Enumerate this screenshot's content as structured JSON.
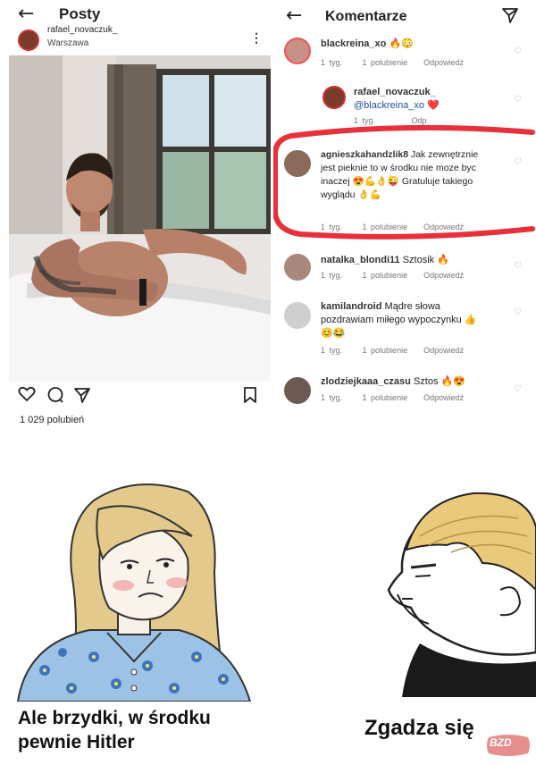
{
  "posts_screen": {
    "title": "Posty",
    "username": "rafael_novaczuk_",
    "location": "Warszawa",
    "likes_text": "1 029 polubień"
  },
  "comments_screen": {
    "title": "Komentarze",
    "comments": [
      {
        "user": "blackreina_xo",
        "text": "🔥😳",
        "time": "1 tyg.",
        "likes": "1 polubienie",
        "reply": "Odpowiedź"
      },
      {
        "user": "rafael_novaczuk_",
        "text": "@blackreina_xo ❤️",
        "time": "1 tyg.",
        "likes": "",
        "reply": "Odp"
      },
      {
        "user": "agnieszkahandzlik8",
        "text": "Jak zewnętrznie jest pieknie to w środku nie moze byc  inaczej 😍💪👌😜 Gratuluje takiego wyglądu 👌💪",
        "time": "1 tyg.",
        "likes": "1 polubienie",
        "reply": "Odpowiedź"
      },
      {
        "user": "natalka_blondi11",
        "text": "Sztosik 🔥",
        "time": "1 tyg.",
        "likes": "1 polubienie",
        "reply": "Odpowiedź"
      },
      {
        "user": "kamilandroid",
        "text": "Mądre słowa pozdrawiam miłego wypoczynku 👍😊😂",
        "time": "1 tyg.",
        "likes": "1 polubienie",
        "reply": "Odpowiedź"
      },
      {
        "user": "zlodziejkaaa_czasu",
        "text": "Sztos 🔥😍",
        "time": "1 tyg.",
        "likes": "1 polubienie",
        "reply": "Odpowiedź"
      }
    ]
  },
  "meme": {
    "left_caption_line1": "Ale brzydki, w środku",
    "left_caption_line2": "pewnie Hitler",
    "right_caption": "Zgadza się",
    "watermark": "BZD"
  },
  "colors": {
    "red_marker": "#e8303a",
    "hair_blonde": "#e9c97a",
    "doomer_hair": "#e3c98b",
    "dress_blue": "#9cc3e6"
  }
}
